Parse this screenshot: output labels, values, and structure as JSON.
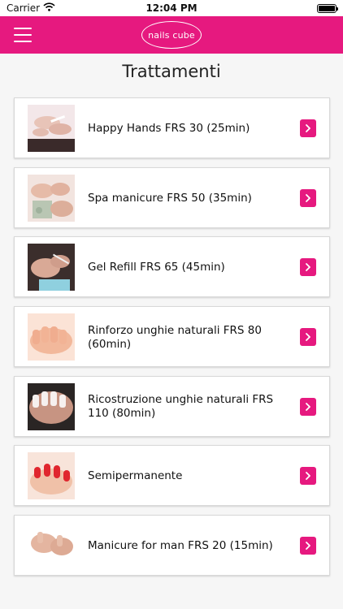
{
  "status_bar": {
    "carrier": "Carrier",
    "time": "12:04 PM"
  },
  "nav": {
    "logo_text": "nails cube",
    "menu_icon": "hamburger-menu-icon"
  },
  "page": {
    "title": "Trattamenti"
  },
  "colors": {
    "accent": "#e6197f",
    "background": "#f6f6f6"
  },
  "treatments": [
    {
      "label": "Happy Hands FRS 30 (25min)",
      "icon": "chevron-right-icon"
    },
    {
      "label": "Spa manicure FRS 50 (35min)",
      "icon": "chevron-right-icon"
    },
    {
      "label": "Gel Refill FRS 65 (45min)",
      "icon": "chevron-right-icon"
    },
    {
      "label": "Rinforzo unghie naturali FRS 80 (60min)",
      "icon": "chevron-right-icon"
    },
    {
      "label": "Ricostruzione unghie naturali FRS 110 (80min)",
      "icon": "chevron-right-icon"
    },
    {
      "label": "Semipermanente",
      "icon": "chevron-right-icon"
    },
    {
      "label": "Manicure for man FRS 20 (15min)",
      "icon": "chevron-right-icon"
    }
  ]
}
